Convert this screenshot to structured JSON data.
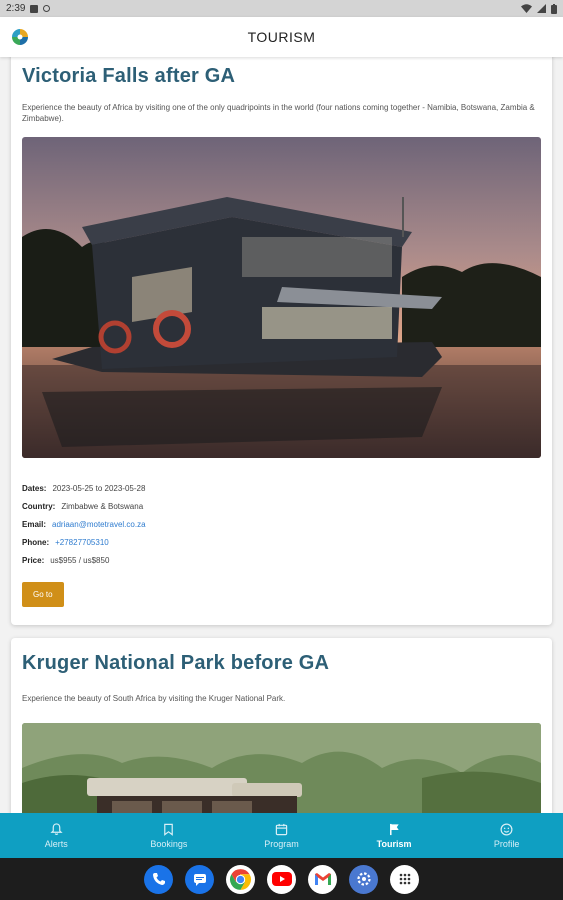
{
  "status_bar": {
    "time": "2:39"
  },
  "header": {
    "title": "TOURISM"
  },
  "tours": [
    {
      "title": "Victoria Falls after GA",
      "description": "Experience the beauty of Africa by visiting one of the only quadripoints in the world (four nations coming together - Namibia, Botswana, Zambia & Zimbabwe).",
      "dates_label": "Dates:",
      "dates": "2023-05-25 to 2023-05-28",
      "country_label": "Country:",
      "country": "Zimbabwe & Botswana",
      "email_label": "Email:",
      "email": "adriaan@motetravel.co.za",
      "phone_label": "Phone:",
      "phone": "+27827705310",
      "price_label": "Price:",
      "price": "us$955 / us$850",
      "button": "Go to"
    },
    {
      "title": "Kruger National Park before GA",
      "description": "Experience the beauty of South Africa by visiting the Kruger National Park."
    }
  ],
  "bottom_nav": [
    {
      "label": "Alerts",
      "icon": "bell-icon"
    },
    {
      "label": "Bookings",
      "icon": "bookmark-icon"
    },
    {
      "label": "Program",
      "icon": "calendar-icon"
    },
    {
      "label": "Tourism",
      "icon": "flag-icon",
      "active": true
    },
    {
      "label": "Profile",
      "icon": "smile-face-icon"
    }
  ],
  "dock_apps": [
    "phone-app-icon",
    "messages-app-icon",
    "chrome-app-icon",
    "youtube-app-icon",
    "gmail-app-icon",
    "settings-app-icon",
    "app-drawer-icon"
  ],
  "colors": {
    "accent": "#0f9fc2",
    "title": "#2d5f76",
    "button": "#d08f18",
    "link": "#2f7ccf"
  }
}
